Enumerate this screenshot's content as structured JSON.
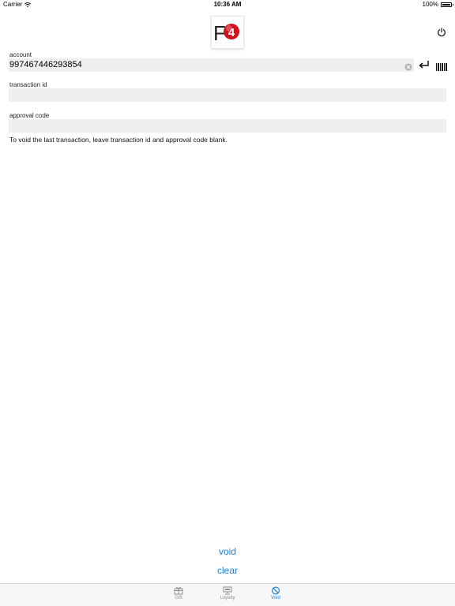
{
  "status_bar": {
    "carrier": "Carrier",
    "time": "10:36 AM",
    "battery": "100%"
  },
  "logo": {
    "letter": "F",
    "badge_number": "4"
  },
  "form": {
    "account_label": "account",
    "account_value": "997467446293854",
    "transaction_label": "transaction id",
    "transaction_value": "",
    "approval_label": "approval code",
    "approval_value": ""
  },
  "hint": "To void the last transaction, leave transaction id and approval code blank.",
  "actions": {
    "void": "void",
    "clear": "clear"
  },
  "tabs": [
    {
      "label": "Gift",
      "icon": "gift-card-icon",
      "active": false
    },
    {
      "label": "Loyalty",
      "icon": "loyalty-terminal-icon",
      "active": false
    },
    {
      "label": "Void",
      "icon": "void-icon",
      "active": true
    }
  ],
  "colors": {
    "accent": "#1b7fd8",
    "field_bg": "#efeff0",
    "logo_red": "#d0121b",
    "inactive_tab": "#8e8e93"
  }
}
